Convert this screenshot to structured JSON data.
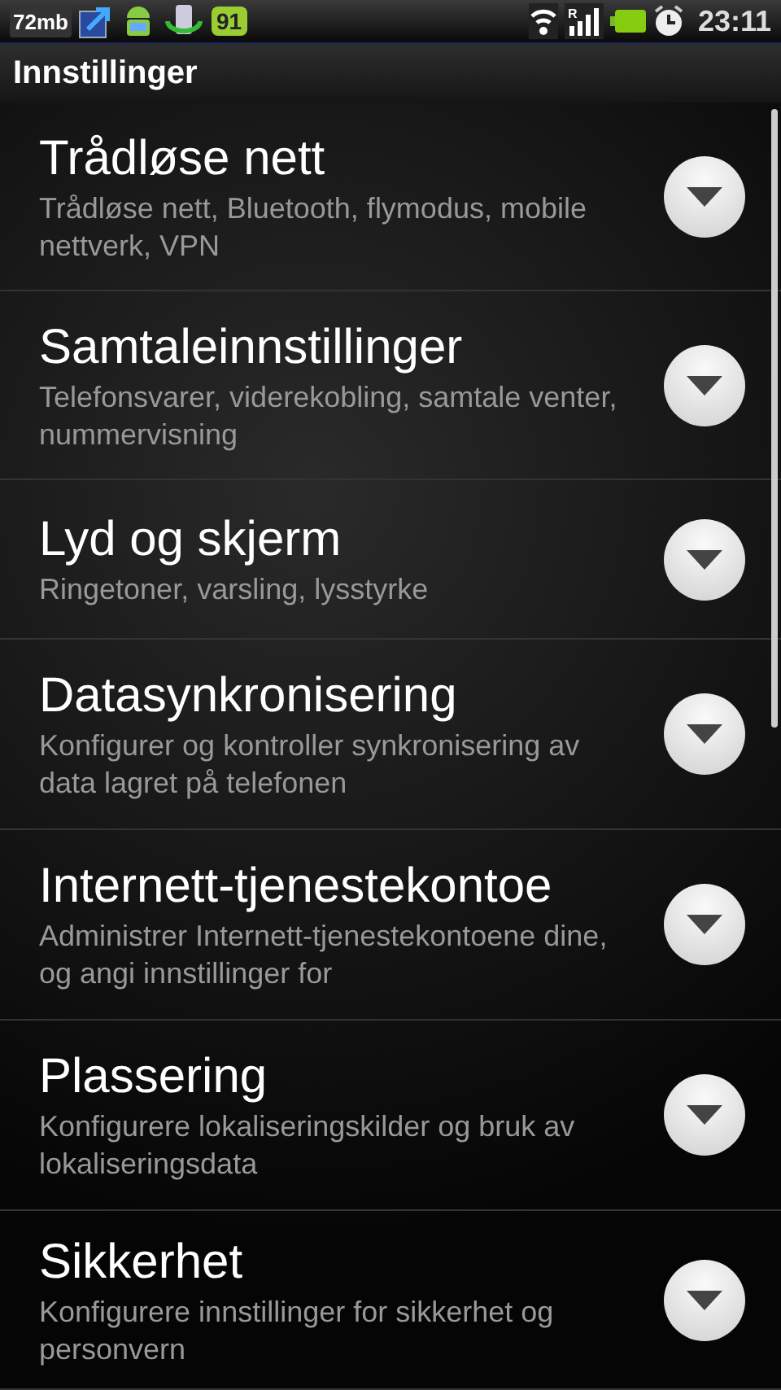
{
  "status_bar": {
    "memory": "72mb",
    "badge": "91",
    "signal_label": "R",
    "time": "23:11"
  },
  "title": "Innstillinger",
  "items": [
    {
      "title": "Trådløse nett",
      "subtitle": "Trådløse nett, Bluetooth, flymodus, mobile nettverk, VPN"
    },
    {
      "title": "Samtaleinnstillinger",
      "subtitle": "Telefonsvarer, viderekobling, samtale venter, nummervisning"
    },
    {
      "title": "Lyd og skjerm",
      "subtitle": "Ringetoner, varsling, lysstyrke"
    },
    {
      "title": "Datasynkronisering",
      "subtitle": "Konfigurer og kontroller synkronisering av data lagret på telefonen"
    },
    {
      "title": "Internett-tjenestekontoe",
      "subtitle": "Administrer Internett-tjenestekontoene dine, og angi innstillinger for"
    },
    {
      "title": "Plassering",
      "subtitle": "Konfigurere lokaliseringskilder og bruk av lokaliseringsdata"
    },
    {
      "title": "Sikkerhet",
      "subtitle": "Konfigurere innstillinger for sikkerhet og personvern"
    }
  ]
}
